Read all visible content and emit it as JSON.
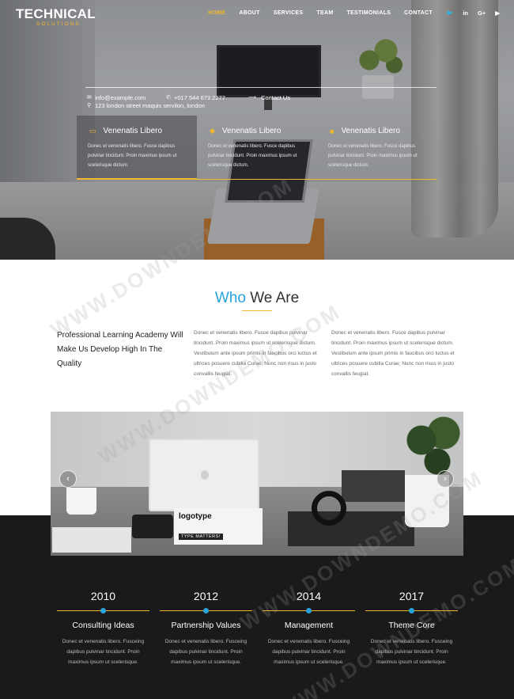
{
  "brand": {
    "name": "TECHNICAL",
    "tagline": "SOLUTIONS"
  },
  "nav": {
    "items": [
      "HOME",
      "ABOUT",
      "SERVICES",
      "TEAM",
      "TESTIMONIALS",
      "CONTACT"
    ],
    "active": "HOME",
    "social_icons": [
      "twitter-icon",
      "linkedin-icon",
      "google-plus-icon",
      "youtube-icon"
    ],
    "social_glyphs": [
      "🐦",
      "in",
      "G+",
      "▶"
    ]
  },
  "contact": {
    "email": "info@example.com",
    "phone": "+017 544 673 2277",
    "address": "123 london street maquis servilon, london",
    "cta": "Contact Us"
  },
  "features": [
    {
      "icon": "laptop-icon",
      "title": "Venenatis Libero",
      "text": "Donec et venenatis libero. Fusce dapibus pulvinar tincidunt. Proin maximus ipsum ut scelerisque dictum."
    },
    {
      "icon": "diamond-icon",
      "title": "Venenatis Libero",
      "text": "Donec et venenatis libero. Fusce dapibus pulvinar tincidunt. Proin maximus ipsum ut scelerisque dictum."
    },
    {
      "icon": "cube-icon",
      "title": "Venenatis Libero",
      "text": "Donec et venenatis libero. Fusce dapibus pulvinar tincidunt. Proin maximus ipsum ut scelerisque dictum."
    }
  ],
  "about": {
    "title_accent": "Who",
    "title_rest": "We Are",
    "lead": "Professional Learning Academy Will Make Us Develop High In The Quality",
    "columns": [
      "Donec et venenatis libero. Fusce dapibus pulvinar tincidunt. Proin maximus ipsum ut scelerisque dictum. Vestibulum ante ipsum primis in faucibus orci luctus et ultrices posuere cubilia Curae; Nunc non risus in justo convallis feugiat.",
      "Donec et venenatis libero. Fusce dapibus pulvinar tincidunt. Proin maximus ipsum ut scelerisque dictum. Vestibulum ante ipsum primis in faucibus orci luctus et ultrices posuere cubilia Curae; Nunc non risus in justo convallis feugiat."
    ]
  },
  "slider": {
    "prev": "‹",
    "next": "›",
    "book_title": "logotype",
    "book_subtitle": "TYPE MATTERS!"
  },
  "timeline": [
    {
      "year": "2010",
      "title": "Consulting Ideas",
      "text": "Donec et venenatis libero. Fusceing dapibus pulvinar tincidunt. Proin maximus ipsum ut scelerisque."
    },
    {
      "year": "2012",
      "title": "Partnership Values",
      "text": "Donec et venenatis libero. Fusceing dapibus pulvinar tincidunt. Proin maximus ipsum ut scelerisque."
    },
    {
      "year": "2014",
      "title": "Management",
      "text": "Donec et venenatis libero. Fusceing dapibus pulvinar tincidunt. Proin maximus ipsum ut scelerisque."
    },
    {
      "year": "2017",
      "title": "Theme Core",
      "text": "Donec et venenatis libero. Fusceing dapibus pulvinar tincidunt. Proin maximus ipsum ut scelerisque."
    }
  ],
  "watermark": "WWW.DOWNDEMO.COM",
  "colors": {
    "accent_blue": "#29a3dc",
    "accent_gold": "#f0b82a",
    "dark_bg": "#1a1a1a"
  }
}
